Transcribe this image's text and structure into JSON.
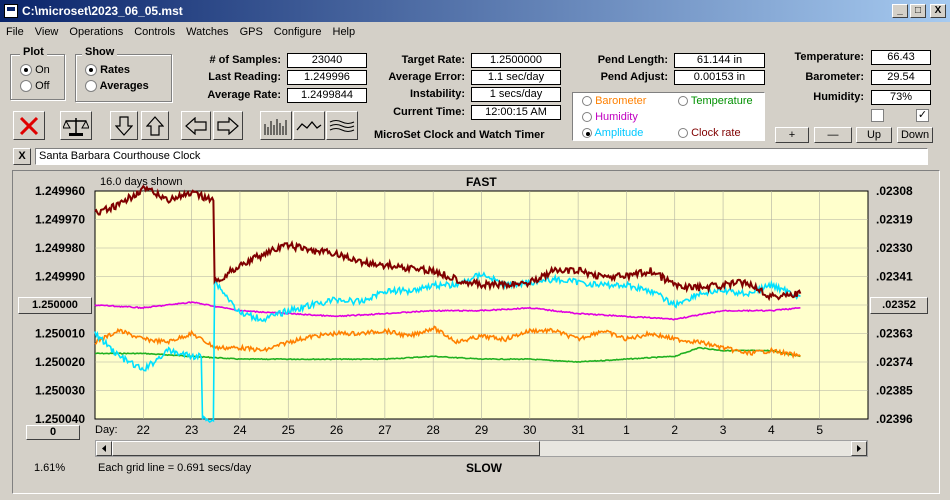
{
  "window": {
    "title": "C:\\microset\\2023_06_05.mst",
    "min_label": "_",
    "max_label": "□",
    "close_label": "X"
  },
  "menu": [
    "File",
    "View",
    "Operations",
    "Controls",
    "Watches",
    "GPS",
    "Configure",
    "Help"
  ],
  "plot_group": {
    "title": "Plot",
    "options": [
      "On",
      "Off"
    ],
    "selected": "On"
  },
  "show_group": {
    "title": "Show",
    "options": [
      "Rates",
      "Averages"
    ],
    "selected": "Rates"
  },
  "stats": {
    "samples_label": "# of Samples:",
    "samples_value": "23040",
    "last_label": "Last Reading:",
    "last_value": "1.249996",
    "avg_label": "Average Rate:",
    "avg_value": "1.2499844"
  },
  "rates": {
    "target_label": "Target Rate:",
    "target_value": "1.2500000",
    "error_label": "Average Error:",
    "error_value": "1.1 sec/day",
    "instab_label": "Instability:",
    "instab_value": "1 secs/day",
    "time_label": "Current Time:",
    "time_value": "12:00:15 AM"
  },
  "app_caption": "MicroSet Clock and Watch Timer",
  "pend": {
    "length_label": "Pend Length:",
    "length_value": "61.144 in",
    "adjust_label": "Pend Adjust:",
    "adjust_value": "0.00153 in"
  },
  "series_select": {
    "options": [
      {
        "label": "Barometer",
        "color": "#ff8000",
        "selected": false
      },
      {
        "label": "Temperature",
        "color": "#009000",
        "selected": false
      },
      {
        "label": "Humidity",
        "color": "#c000c0",
        "selected": false
      },
      {
        "label": "Amplitude",
        "color": "#00c8ff",
        "selected": true
      },
      {
        "label": "Clock rate",
        "color": "#800000",
        "selected": false
      }
    ]
  },
  "env": {
    "temp_label": "Temperature:",
    "temp_value": "66.43",
    "baro_label": "Barometer:",
    "baro_value": "29.54",
    "hum_label": "Humidity:",
    "hum_value": "73%",
    "check1": false,
    "check2": true,
    "check2_mark": "✓"
  },
  "env_buttons": [
    "+",
    "—",
    "Up",
    "Down"
  ],
  "clock_name": {
    "close_label": "X",
    "value": "Santa Barbara Courthouse Clock"
  },
  "chart": {
    "days_shown": "16.0 days shown",
    "top_label": "FAST",
    "bottom_label": "SLOW",
    "day_label": "Day:",
    "grid_note": "Each grid line = 0.691 secs/day",
    "percent": "1.61%",
    "center_button": "1.250000",
    "zero_button": "0",
    "right_button": ".02352"
  },
  "chart_data": {
    "type": "line",
    "left_ticks": [
      "1.249960",
      "1.249970",
      "1.249980",
      "1.249990",
      "1.250000",
      "1.250010",
      "1.250020",
      "1.250030",
      "1.250040"
    ],
    "right_ticks": [
      ".02308",
      ".02319",
      ".02330",
      ".02341",
      ".02352",
      ".02363",
      ".02374",
      ".02385",
      ".02396"
    ],
    "x_ticks": [
      "22",
      "23",
      "24",
      "25",
      "26",
      "27",
      "28",
      "29",
      "30",
      "31",
      "1",
      "2",
      "3",
      "4",
      "5"
    ],
    "ylim": [
      1.24996,
      1.25004
    ],
    "series": [
      {
        "name": "Clock rate",
        "color": "#800000",
        "x": [
          21.0,
          21.5,
          22.0,
          22.5,
          23.0,
          23.45,
          23.5,
          24.0,
          24.5,
          25.0,
          25.5,
          26.0,
          26.5,
          27.0,
          27.5,
          28.0,
          28.5,
          29.0,
          29.5,
          30.0,
          30.5,
          31.0,
          31.5,
          32.0,
          32.5,
          33.0,
          33.5,
          34.0,
          34.5,
          35.0,
          35.6
        ],
        "y": [
          1.249968,
          1.249965,
          1.249959,
          1.249963,
          1.249961,
          1.249963,
          1.249992,
          1.249986,
          1.249982,
          1.249979,
          1.249981,
          1.249982,
          1.249985,
          1.249986,
          1.249987,
          1.249988,
          1.249991,
          1.249993,
          1.249993,
          1.249992,
          1.249988,
          1.249988,
          1.24999,
          1.24999,
          1.249988,
          1.249993,
          1.249994,
          1.249993,
          1.249992,
          1.249997,
          1.249996
        ]
      },
      {
        "name": "Amplitude",
        "color": "#00e0ff",
        "x": [
          21.0,
          21.5,
          22.0,
          22.5,
          23.0,
          23.45,
          23.5,
          24.0,
          24.5,
          25.0,
          25.5,
          26.0,
          26.5,
          27.0,
          27.5,
          28.0,
          28.5,
          29.0,
          29.5,
          30.0,
          30.5,
          31.0,
          31.5,
          32.0,
          32.5,
          33.0,
          33.5,
          34.0,
          34.5,
          35.0,
          35.6
        ],
        "y": [
          1.25001,
          1.250018,
          1.250023,
          1.250016,
          1.250018,
          1.25004,
          1.249992,
          1.250003,
          1.250005,
          1.250002,
          1.25,
          1.249998,
          1.249999,
          1.249995,
          1.249995,
          1.249993,
          1.249993,
          1.249989,
          1.249993,
          1.249992,
          1.249991,
          1.249992,
          1.249993,
          1.249993,
          1.249995,
          1.25,
          1.249996,
          1.249995,
          1.249996,
          1.249993,
          1.249997
        ]
      },
      {
        "name": "Humidity",
        "color": "#e000e0",
        "x": [
          21.0,
          22.0,
          23.0,
          24.0,
          25.0,
          26.0,
          27.0,
          28.0,
          29.0,
          30.0,
          31.0,
          32.0,
          33.0,
          34.0,
          35.0,
          35.6
        ],
        "y": [
          1.25,
          1.250001,
          1.249999,
          1.250002,
          1.250003,
          1.250004,
          1.250003,
          1.250002,
          1.250002,
          1.250001,
          1.250003,
          1.250004,
          1.250005,
          1.250002,
          1.250002,
          1.250001
        ]
      },
      {
        "name": "Barometer",
        "color": "#ff8000",
        "x": [
          21.0,
          21.5,
          22.0,
          22.5,
          23.0,
          23.5,
          24.0,
          24.5,
          25.0,
          25.5,
          26.0,
          26.5,
          27.0,
          27.5,
          28.0,
          28.5,
          29.0,
          29.5,
          30.0,
          30.5,
          31.0,
          31.5,
          32.0,
          32.5,
          33.0,
          33.5,
          34.0,
          34.5,
          35.0,
          35.6
        ],
        "y": [
          1.250013,
          1.250009,
          1.250012,
          1.250013,
          1.25001,
          1.250015,
          1.250015,
          1.250016,
          1.250013,
          1.250011,
          1.25001,
          1.25001,
          1.250009,
          1.250011,
          1.250008,
          1.250013,
          1.250011,
          1.250012,
          1.250009,
          1.250009,
          1.250012,
          1.250009,
          1.250012,
          1.25001,
          1.250012,
          1.250013,
          1.250015,
          1.250017,
          1.250016,
          1.250018
        ]
      },
      {
        "name": "Temperature",
        "color": "#20b020",
        "x": [
          21.0,
          22.0,
          23.0,
          24.0,
          25.0,
          26.0,
          27.0,
          28.0,
          29.0,
          30.0,
          31.0,
          32.0,
          33.0,
          33.5,
          34.0,
          34.5,
          35.0,
          35.6
        ],
        "y": [
          1.250017,
          1.250017,
          1.250018,
          1.250019,
          1.250019,
          1.250019,
          1.250019,
          1.250018,
          1.250019,
          1.250019,
          1.25002,
          1.250019,
          1.250018,
          1.250015,
          1.250016,
          1.250016,
          1.250016,
          1.250018
        ]
      }
    ]
  }
}
